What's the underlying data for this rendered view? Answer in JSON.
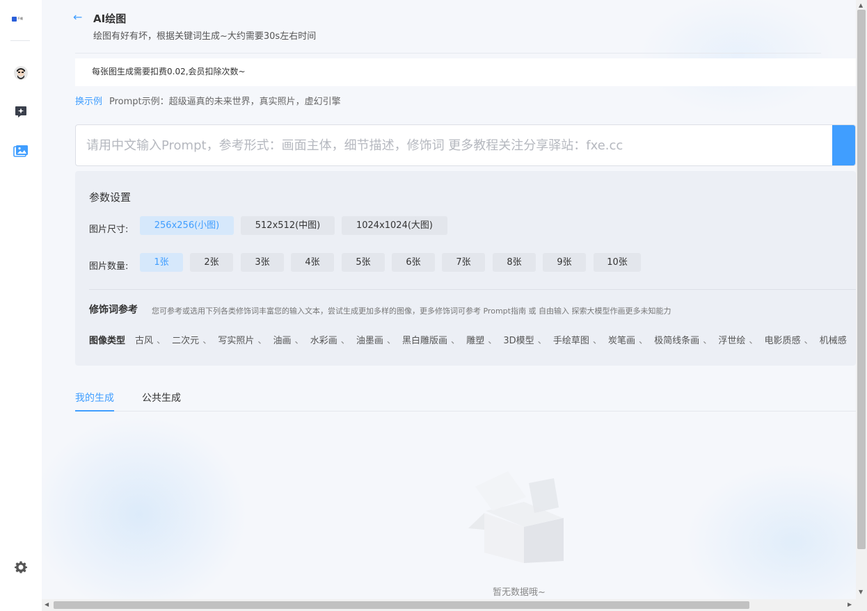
{
  "sidebar": {
    "logo_text": "千维",
    "icons": [
      "avatar",
      "sparkle-icon",
      "gallery-icon",
      "gear-icon"
    ]
  },
  "header": {
    "back_icon": "←",
    "title": "AI绘图",
    "subtitle": "绘图有好有坏，根据关键词生成~大约需要30s左右时间"
  },
  "notice": "每张图生成需要扣费0.02,会员扣除次数~",
  "example": {
    "swap_label": "换示例",
    "text": "Prompt示例：超级逼真的未来世界，真实照片，虚幻引擎"
  },
  "prompt": {
    "placeholder": "请用中文输入Prompt，参考形式：画面主体，细节描述，修饰词 更多教程关注分享驿站：fxe.cc"
  },
  "params": {
    "title": "参数设置",
    "size_label": "图片尺寸:",
    "sizes": [
      "256x256(小图)",
      "512x512(中图)",
      "1024x1024(大图)"
    ],
    "count_label": "图片数量:",
    "counts": [
      "1张",
      "2张",
      "3张",
      "4张",
      "5张",
      "6张",
      "7张",
      "8张",
      "9张",
      "10张"
    ],
    "modifier_title": "修饰词参考",
    "modifier_desc": "您可参考或选用下列各类修饰词丰富您的输入文本，尝试生成更加多样的图像，更多修饰词可参考 Prompt指南 或 自由输入 探索大模型作画更多未知能力",
    "image_type_label": "图像类型",
    "image_types": [
      "古风",
      "二次元",
      "写实照片",
      "油画",
      "水彩画",
      "油墨画",
      "黑白雕版画",
      "雕塑",
      "3D模型",
      "手绘草图",
      "炭笔画",
      "极简线条画",
      "浮世绘",
      "电影质感",
      "机械感"
    ]
  },
  "tabs": {
    "mine": "我的生成",
    "public": "公共生成"
  },
  "empty_text": "暂无数据哦~",
  "colors": {
    "accent": "#409eff",
    "active_option_bg": "#d6e8fb",
    "option_bg": "#e3e6ec"
  }
}
